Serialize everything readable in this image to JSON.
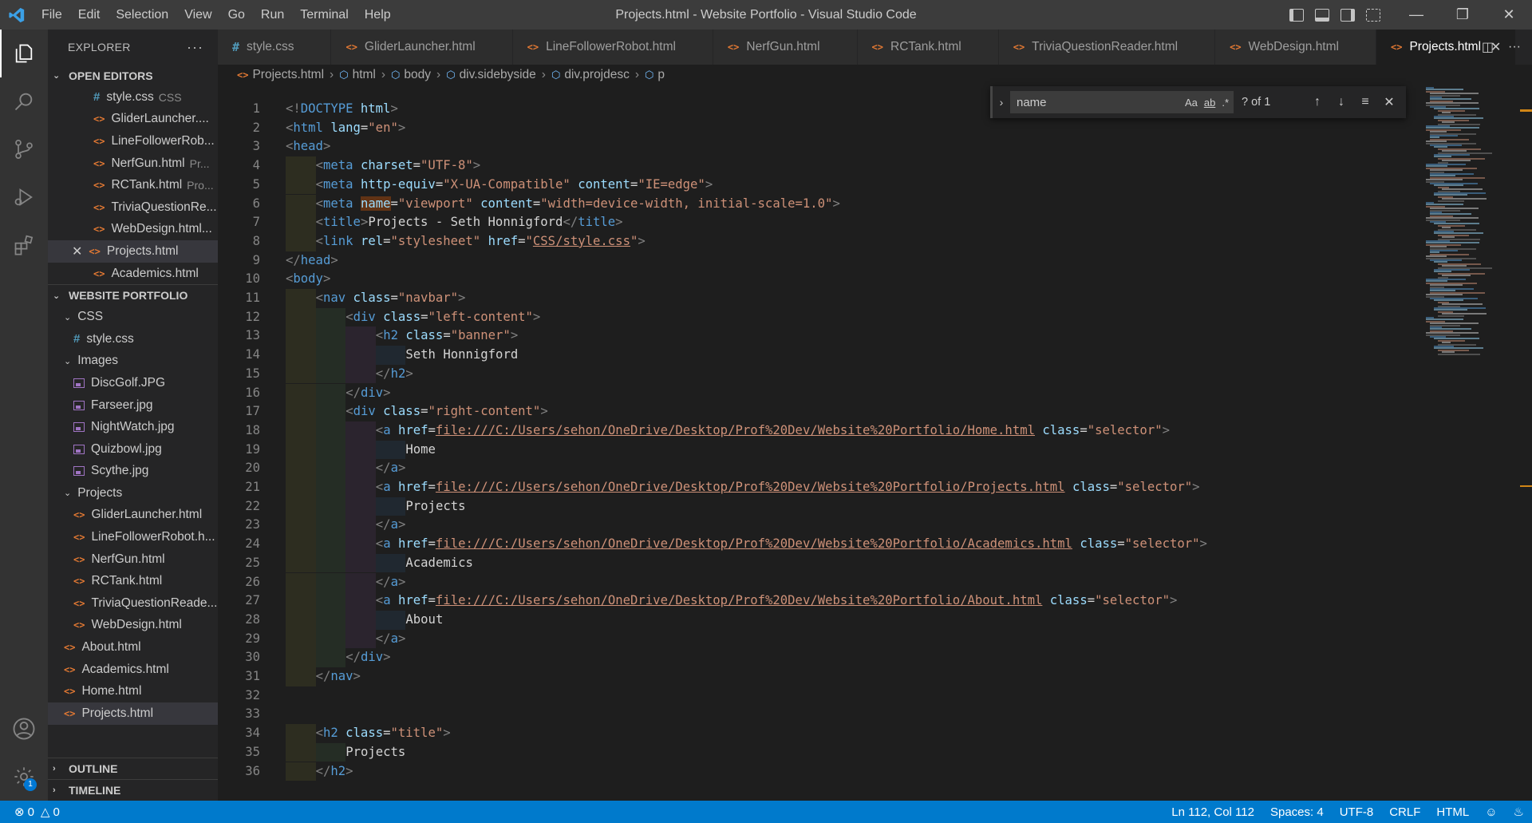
{
  "window": {
    "title": "Projects.html - Website Portfolio - Visual Studio Code",
    "menu": [
      "File",
      "Edit",
      "Selection",
      "View",
      "Go",
      "Run",
      "Terminal",
      "Help"
    ]
  },
  "sidebar": {
    "header": "EXPLORER",
    "open_editors_label": "OPEN EDITORS",
    "open_editors": [
      {
        "name": "style.css",
        "desc": "CSS",
        "type": "css"
      },
      {
        "name": "GliderLauncher....",
        "desc": "",
        "type": "html"
      },
      {
        "name": "LineFollowerRob...",
        "desc": "",
        "type": "html"
      },
      {
        "name": "NerfGun.html",
        "desc": "Pr...",
        "type": "html"
      },
      {
        "name": "RCTank.html",
        "desc": "Pro...",
        "type": "html"
      },
      {
        "name": "TriviaQuestionRe...",
        "desc": "",
        "type": "html"
      },
      {
        "name": "WebDesign.html...",
        "desc": "",
        "type": "html"
      },
      {
        "name": "Projects.html",
        "desc": "",
        "type": "html"
      },
      {
        "name": "Academics.html",
        "desc": "",
        "type": "html"
      }
    ],
    "workspace_label": "WEBSITE PORTFOLIO",
    "tree": {
      "css_folder": "CSS",
      "css_file": "style.css",
      "images_folder": "Images",
      "images": [
        "DiscGolf.JPG",
        "Farseer.jpg",
        "NightWatch.jpg",
        "Quizbowl.jpg",
        "Scythe.jpg"
      ],
      "projects_folder": "Projects",
      "projects": [
        "GliderLauncher.html",
        "LineFollowerRobot.h...",
        "NerfGun.html",
        "RCTank.html",
        "TriviaQuestionReade...",
        "WebDesign.html"
      ],
      "root_files": [
        "About.html",
        "Academics.html",
        "Home.html",
        "Projects.html"
      ]
    },
    "outline_label": "OUTLINE",
    "timeline_label": "TIMELINE"
  },
  "tabs": [
    {
      "label": "style.css",
      "type": "css"
    },
    {
      "label": "GliderLauncher.html",
      "type": "html"
    },
    {
      "label": "LineFollowerRobot.html",
      "type": "html"
    },
    {
      "label": "NerfGun.html",
      "type": "html"
    },
    {
      "label": "RCTank.html",
      "type": "html"
    },
    {
      "label": "TriviaQuestionReader.html",
      "type": "html"
    },
    {
      "label": "WebDesign.html",
      "type": "html"
    },
    {
      "label": "Projects.html",
      "type": "html",
      "active": true
    }
  ],
  "breadcrumb": [
    "Projects.html",
    "html",
    "body",
    "div.sidebyside",
    "div.projdesc",
    "p"
  ],
  "find": {
    "value": "name",
    "case_label": "Aa",
    "word_label": "ab",
    "regex_label": ".*",
    "count": "? of 1"
  },
  "editor": {
    "lines": [
      {
        "n": "1",
        "indent": 0,
        "ws": 0,
        "html": "<span class='pu'>&lt;!</span><span class='tg'>DOCTYPE</span> <span class='at'>html</span><span class='pu'>&gt;</span>"
      },
      {
        "n": "2",
        "indent": 0,
        "ws": 0,
        "html": "<span class='pu'>&lt;</span><span class='tg'>html</span> <span class='at'>lang</span><span class='tx'>=</span><span class='st'>\"en\"</span><span class='pu'>&gt;</span>"
      },
      {
        "n": "3",
        "indent": 0,
        "ws": 0,
        "html": "<span class='pu'>&lt;</span><span class='tg'>head</span><span class='pu'>&gt;</span>"
      },
      {
        "n": "4",
        "indent": 1,
        "ws": 1,
        "html": "<span class='pu'>&lt;</span><span class='tg'>meta</span> <span class='at'>charset</span><span class='tx'>=</span><span class='st'>\"UTF-8\"</span><span class='pu'>&gt;</span>"
      },
      {
        "n": "5",
        "indent": 1,
        "ws": 1,
        "html": "<span class='pu'>&lt;</span><span class='tg'>meta</span> <span class='at'>http-equiv</span><span class='tx'>=</span><span class='st'>\"X-UA-Compatible\"</span> <span class='at'>content</span><span class='tx'>=</span><span class='st'>\"IE=edge\"</span><span class='pu'>&gt;</span>"
      },
      {
        "n": "6",
        "indent": 1,
        "ws": 1,
        "html": "<span class='pu'>&lt;</span><span class='tg'>meta</span> <span class='at hl'>name</span><span class='tx'>=</span><span class='st'>\"viewport\"</span> <span class='at'>content</span><span class='tx'>=</span><span class='st'>\"width=device-width, initial-scale=1.0\"</span><span class='pu'>&gt;</span>"
      },
      {
        "n": "7",
        "indent": 1,
        "ws": 1,
        "html": "<span class='pu'>&lt;</span><span class='tg'>title</span><span class='pu'>&gt;</span><span class='tx'>Projects - Seth Honnigford</span><span class='pu'>&lt;/</span><span class='tg'>title</span><span class='pu'>&gt;</span>"
      },
      {
        "n": "8",
        "indent": 1,
        "ws": 1,
        "html": "<span class='pu'>&lt;</span><span class='tg'>link</span> <span class='at'>rel</span><span class='tx'>=</span><span class='st'>\"stylesheet\"</span> <span class='at'>href</span><span class='tx'>=</span><span class='st'>\"</span><span class='lk'>CSS/style.css</span><span class='st'>\"</span><span class='pu'>&gt;</span>"
      },
      {
        "n": "9",
        "indent": 0,
        "ws": 0,
        "html": "<span class='pu'>&lt;/</span><span class='tg'>head</span><span class='pu'>&gt;</span>"
      },
      {
        "n": "10",
        "indent": 0,
        "ws": 0,
        "html": "<span class='pu'>&lt;</span><span class='tg'>body</span><span class='pu'>&gt;</span>"
      },
      {
        "n": "11",
        "indent": 1,
        "ws": 1,
        "html": "<span class='pu'>&lt;</span><span class='tg'>nav</span> <span class='at'>class</span><span class='tx'>=</span><span class='st'>\"navbar\"</span><span class='pu'>&gt;</span>"
      },
      {
        "n": "12",
        "indent": 2,
        "ws": 2,
        "html": "<span class='pu'>&lt;</span><span class='tg'>div</span> <span class='at'>class</span><span class='tx'>=</span><span class='st'>\"left-content\"</span><span class='pu'>&gt;</span>"
      },
      {
        "n": "13",
        "indent": 3,
        "ws": 3,
        "html": "<span class='pu'>&lt;</span><span class='tg'>h2</span> <span class='at'>class</span><span class='tx'>=</span><span class='st'>\"banner\"</span><span class='pu'>&gt;</span>"
      },
      {
        "n": "14",
        "indent": 4,
        "ws": 4,
        "html": "<span class='tx'>Seth Honnigford</span>"
      },
      {
        "n": "15",
        "indent": 3,
        "ws": 3,
        "html": "<span class='pu'>&lt;/</span><span class='tg'>h2</span><span class='pu'>&gt;</span>"
      },
      {
        "n": "16",
        "indent": 2,
        "ws": 2,
        "html": "<span class='pu'>&lt;/</span><span class='tg'>div</span><span class='pu'>&gt;</span>"
      },
      {
        "n": "17",
        "indent": 2,
        "ws": 2,
        "html": "<span class='pu'>&lt;</span><span class='tg'>div</span> <span class='at'>class</span><span class='tx'>=</span><span class='st'>\"right-content\"</span><span class='pu'>&gt;</span>"
      },
      {
        "n": "18",
        "indent": 3,
        "ws": 3,
        "html": "<span class='pu'>&lt;</span><span class='tg'>a</span> <span class='at'>href</span><span class='tx'>=</span><span class='lk'>file:///C:/Users/sehon/OneDrive/Desktop/Prof%20Dev/Website%20Portfolio/Home.html</span> <span class='at'>class</span><span class='tx'>=</span><span class='st'>\"selector\"</span><span class='pu'>&gt;</span>"
      },
      {
        "n": "19",
        "indent": 4,
        "ws": 4,
        "html": "<span class='tx'>Home</span>"
      },
      {
        "n": "20",
        "indent": 3,
        "ws": 3,
        "html": "<span class='pu'>&lt;/</span><span class='tg'>a</span><span class='pu'>&gt;</span>"
      },
      {
        "n": "21",
        "indent": 3,
        "ws": 3,
        "html": "<span class='pu'>&lt;</span><span class='tg'>a</span> <span class='at'>href</span><span class='tx'>=</span><span class='lk'>file:///C:/Users/sehon/OneDrive/Desktop/Prof%20Dev/Website%20Portfolio/Projects.html</span> <span class='at'>class</span><span class='tx'>=</span><span class='st'>\"selector\"</span><span class='pu'>&gt;</span>"
      },
      {
        "n": "22",
        "indent": 4,
        "ws": 4,
        "html": "<span class='tx'>Projects</span>"
      },
      {
        "n": "23",
        "indent": 3,
        "ws": 3,
        "html": "<span class='pu'>&lt;/</span><span class='tg'>a</span><span class='pu'>&gt;</span>"
      },
      {
        "n": "24",
        "indent": 3,
        "ws": 3,
        "html": "<span class='pu'>&lt;</span><span class='tg'>a</span> <span class='at'>href</span><span class='tx'>=</span><span class='lk'>file:///C:/Users/sehon/OneDrive/Desktop/Prof%20Dev/Website%20Portfolio/Academics.html</span> <span class='at'>class</span><span class='tx'>=</span><span class='st'>\"selector\"</span><span class='pu'>&gt;</span>"
      },
      {
        "n": "25",
        "indent": 4,
        "ws": 4,
        "html": "<span class='tx'>Academics</span>"
      },
      {
        "n": "26",
        "indent": 3,
        "ws": 3,
        "html": "<span class='pu'>&lt;/</span><span class='tg'>a</span><span class='pu'>&gt;</span>"
      },
      {
        "n": "27",
        "indent": 3,
        "ws": 3,
        "html": "<span class='pu'>&lt;</span><span class='tg'>a</span> <span class='at'>href</span><span class='tx'>=</span><span class='lk'>file:///C:/Users/sehon/OneDrive/Desktop/Prof%20Dev/Website%20Portfolio/About.html</span> <span class='at'>class</span><span class='tx'>=</span><span class='st'>\"selector\"</span><span class='pu'>&gt;</span>"
      },
      {
        "n": "28",
        "indent": 4,
        "ws": 4,
        "html": "<span class='tx'>About</span>"
      },
      {
        "n": "29",
        "indent": 3,
        "ws": 3,
        "html": "<span class='pu'>&lt;/</span><span class='tg'>a</span><span class='pu'>&gt;</span>"
      },
      {
        "n": "30",
        "indent": 2,
        "ws": 2,
        "html": "<span class='pu'>&lt;/</span><span class='tg'>div</span><span class='pu'>&gt;</span>"
      },
      {
        "n": "31",
        "indent": 1,
        "ws": 1,
        "html": "<span class='pu'>&lt;/</span><span class='tg'>nav</span><span class='pu'>&gt;</span>"
      },
      {
        "n": "32",
        "indent": 0,
        "ws": 0,
        "html": ""
      },
      {
        "n": "33",
        "indent": 0,
        "ws": 0,
        "html": ""
      },
      {
        "n": "34",
        "indent": 1,
        "ws": 1,
        "html": "<span class='pu'>&lt;</span><span class='tg'>h2</span> <span class='at'>class</span><span class='tx'>=</span><span class='st'>\"title\"</span><span class='pu'>&gt;</span>"
      },
      {
        "n": "35",
        "indent": 2,
        "ws": 2,
        "html": "<span class='tx'>Projects</span>"
      },
      {
        "n": "36",
        "indent": 1,
        "ws": 1,
        "html": "<span class='pu'>&lt;/</span><span class='tg'>h2</span><span class='pu'>&gt;</span>"
      }
    ]
  },
  "status": {
    "errors": "0",
    "warnings": "0",
    "position": "Ln 112, Col 112",
    "spaces": "Spaces: 4",
    "encoding": "UTF-8",
    "eol": "CRLF",
    "language": "HTML",
    "notifications_badge": "1"
  },
  "colors": {
    "accent": "#007acc",
    "html_icon": "#e37933",
    "css_icon": "#519aba",
    "image_icon": "#a074c4"
  }
}
